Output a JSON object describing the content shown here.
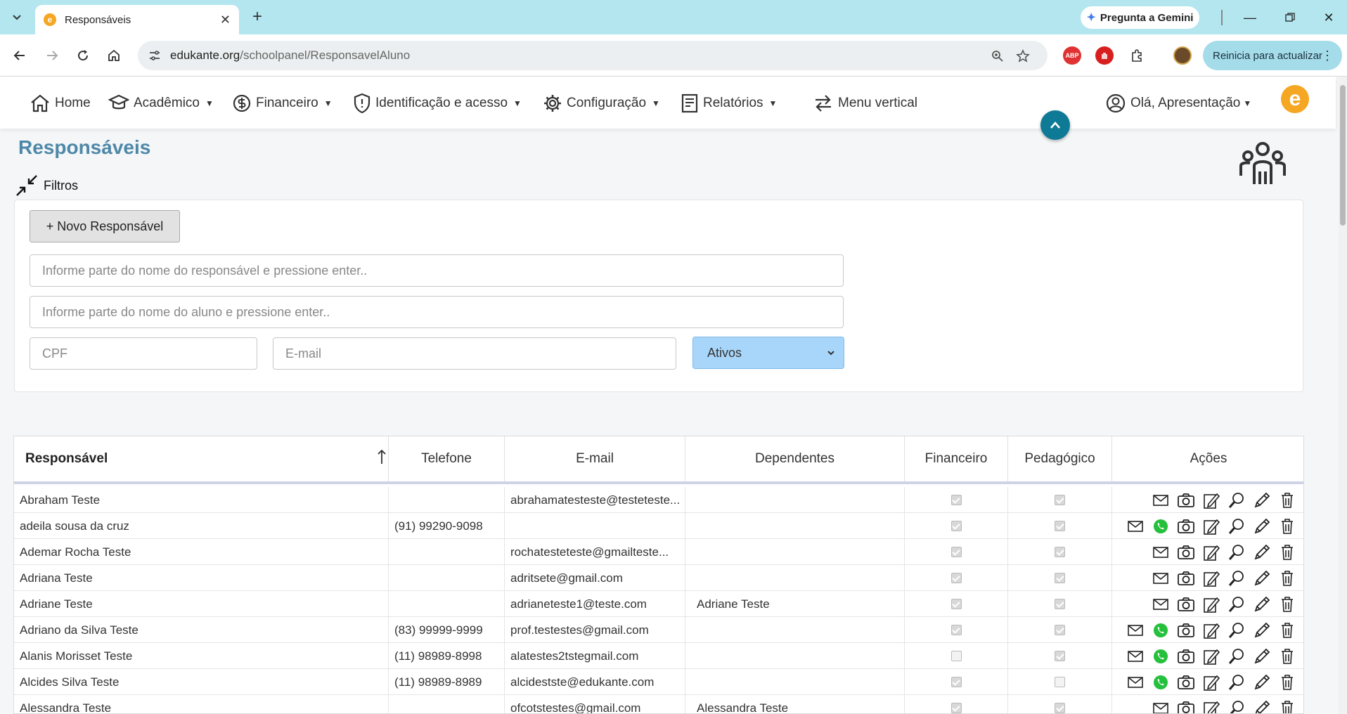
{
  "browser": {
    "tab_title": "Responsáveis",
    "favicon_letter": "e",
    "gemini_label": "Pregunta a Gemini",
    "url_host": "edukante.org",
    "url_path": "/schoolpanel/ResponsavelAluno",
    "abp_label": "ABP",
    "update_label": "Reinicia para actualizar"
  },
  "nav": {
    "home": "Home",
    "academico": "Acadêmico",
    "financeiro": "Financeiro",
    "identificacao": "Identificação e acesso",
    "configuracao": "Configuração",
    "relatorios": "Relatórios",
    "menu_vertical": "Menu vertical",
    "user": "Olá, Apresentação",
    "logo_letter": "e"
  },
  "page": {
    "title": "Responsáveis",
    "filters_label": "Filtros",
    "new_button": "+ Novo Responsável",
    "search_responsavel_placeholder": "Informe parte do nome do responsável e pressione enter..",
    "search_aluno_placeholder": "Informe parte do nome do aluno e pressione enter..",
    "cpf_placeholder": "CPF",
    "email_placeholder": "E-mail",
    "status_selected": "Ativos"
  },
  "table": {
    "headers": {
      "responsavel": "Responsável",
      "telefone": "Telefone",
      "email": "E-mail",
      "dependentes": "Dependentes",
      "financeiro": "Financeiro",
      "pedagogico": "Pedagógico",
      "acoes": "Ações"
    },
    "rows": [
      {
        "name": "Abraham Teste",
        "phone": "",
        "email": "abrahamatesteste@testeteste...",
        "dependents": "",
        "financeiro": true,
        "pedagogico": true,
        "whatsapp": false
      },
      {
        "name": "adeila sousa da cruz",
        "phone": "(91) 99290-9098",
        "email": "",
        "dependents": "",
        "financeiro": true,
        "pedagogico": true,
        "whatsapp": true
      },
      {
        "name": "Ademar Rocha Teste",
        "phone": "",
        "email": "rochatesteteste@gmailteste...",
        "dependents": "",
        "financeiro": true,
        "pedagogico": true,
        "whatsapp": false
      },
      {
        "name": "Adriana Teste",
        "phone": "",
        "email": "adritsete@gmail.com",
        "dependents": "",
        "financeiro": true,
        "pedagogico": true,
        "whatsapp": false
      },
      {
        "name": "Adriane Teste",
        "phone": "",
        "email": "adrianeteste1@teste.com",
        "dependents": "Adriane Teste",
        "financeiro": true,
        "pedagogico": true,
        "whatsapp": false
      },
      {
        "name": "Adriano da Silva Teste",
        "phone": "(83) 99999-9999",
        "email": "prof.testestes@gmail.com",
        "dependents": "",
        "financeiro": true,
        "pedagogico": true,
        "whatsapp": true
      },
      {
        "name": "Alanis Morisset Teste",
        "phone": "(11) 98989-8998",
        "email": "alatestes2tstegmail.com",
        "dependents": "",
        "financeiro": false,
        "pedagogico": true,
        "whatsapp": true
      },
      {
        "name": "Alcides Silva Teste",
        "phone": "(11) 98989-8989",
        "email": "alcidestste@edukante.com",
        "dependents": "",
        "financeiro": true,
        "pedagogico": false,
        "whatsapp": true
      },
      {
        "name": "Alessandra Teste",
        "phone": "",
        "email": "ofcotstestes@gmail.com",
        "dependents": "Alessandra Teste",
        "financeiro": true,
        "pedagogico": true,
        "whatsapp": false
      }
    ]
  },
  "colors": {
    "accent": "#4e88a8",
    "logo": "#f5a623",
    "whatsapp": "#25c03c",
    "select_bg": "#a8d6fa"
  }
}
